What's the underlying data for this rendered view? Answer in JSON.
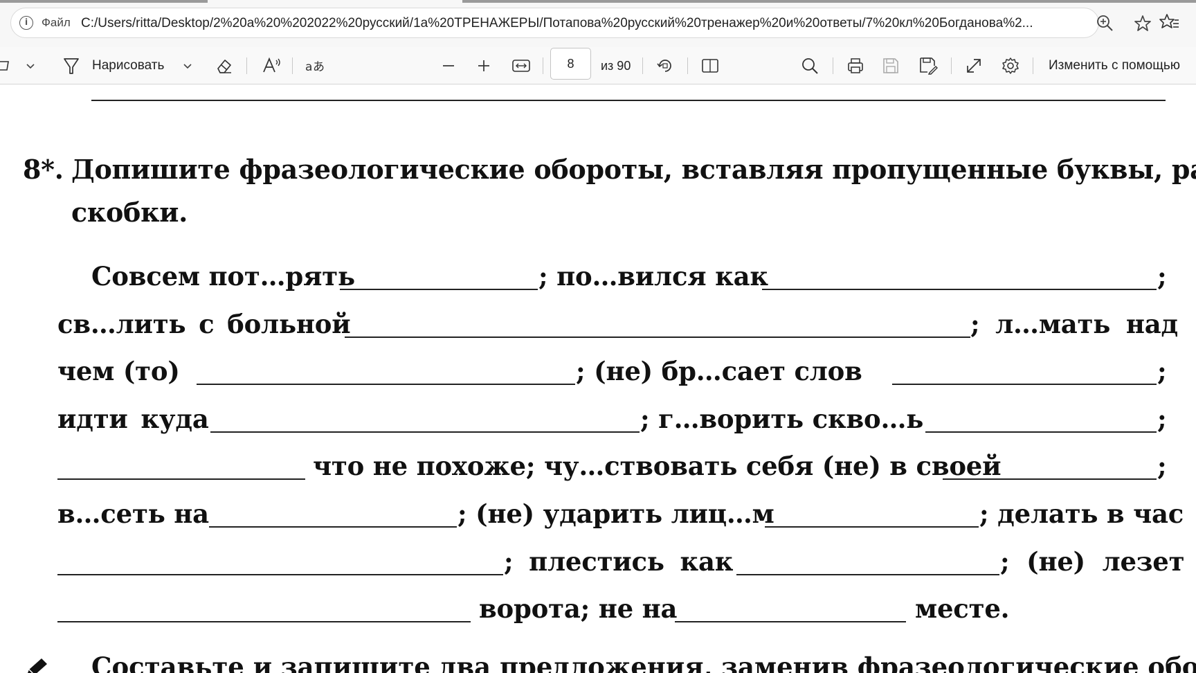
{
  "browser": {
    "address_prefix": "Файл",
    "url": "C:/Users/ritta/Desktop/2%20a%20%202022%20русский/1a%20ТРЕНАЖЕРЫ/Потапова%20русский%20тренажер%20и%20ответы/7%20кл%20Богданова%2..."
  },
  "toolbar": {
    "draw_label": "Нарисовать",
    "page_number": "8",
    "page_total": "из 90",
    "edit_with_label": "Изменить с помощью"
  },
  "exercise": {
    "number": "8*.",
    "title_line1": "Допишите фразеологические обороты, вставляя пропущенные буквы, раскрывая",
    "title_line2": "скобки.",
    "lines": [
      [
        "Совсем пот…рять",
        "; по…вился как",
        ";"
      ],
      [
        "св…лить с больной",
        "; л…мать над"
      ],
      [
        "чем  (то)",
        ";  (не)  бр…сает  слов",
        ";"
      ],
      [
        "идти  куда",
        "; г…ворить скво…ь",
        ";"
      ],
      [
        "что не похоже; чу…ствовать себя (не) в своей",
        ";"
      ],
      [
        "в…сеть на",
        "; (не) ударить лиц…м",
        "; делать в час"
      ],
      [
        ";  плестись  как",
        ";  (не)  лезет"
      ],
      [
        "ворота; не на",
        "месте."
      ]
    ],
    "next_exercise_fragment": "Составьте и запишите два предложения, заменив фразеологические обороты"
  }
}
